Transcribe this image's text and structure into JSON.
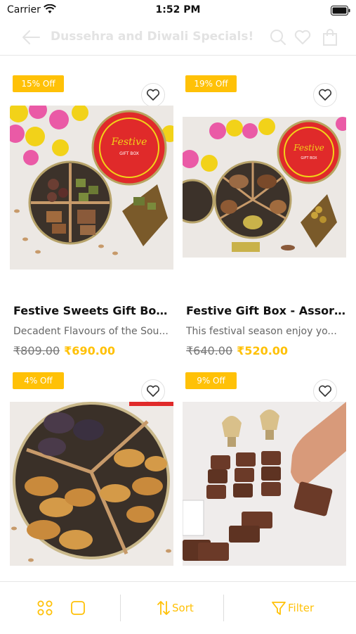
{
  "status_bar": {
    "carrier": "Carrier",
    "time": "1:52 PM"
  },
  "nav": {
    "title": "Dussehra and Diwali Specials!"
  },
  "products": [
    {
      "badge": "15% Off",
      "name": "Festive Sweets Gift Box -...",
      "description": "Decadent Flavours of the Sou...",
      "old_price": "₹809.00",
      "price": "₹690.00"
    },
    {
      "badge": "19% Off",
      "name": "Festive Gift Box - Assorte...",
      "description": "This festival season enjoy yo...",
      "old_price": "₹640.00",
      "price": "₹520.00"
    },
    {
      "badge": "4% Off",
      "name": "",
      "description": "",
      "old_price": "",
      "price": ""
    },
    {
      "badge": "9% Off",
      "name": "",
      "description": "",
      "old_price": "",
      "price": ""
    }
  ],
  "bottom_bar": {
    "sort_label": "Sort",
    "filter_label": "Filter"
  },
  "colors": {
    "accent": "#ffc107",
    "muted_title": "#e3e3e3"
  }
}
